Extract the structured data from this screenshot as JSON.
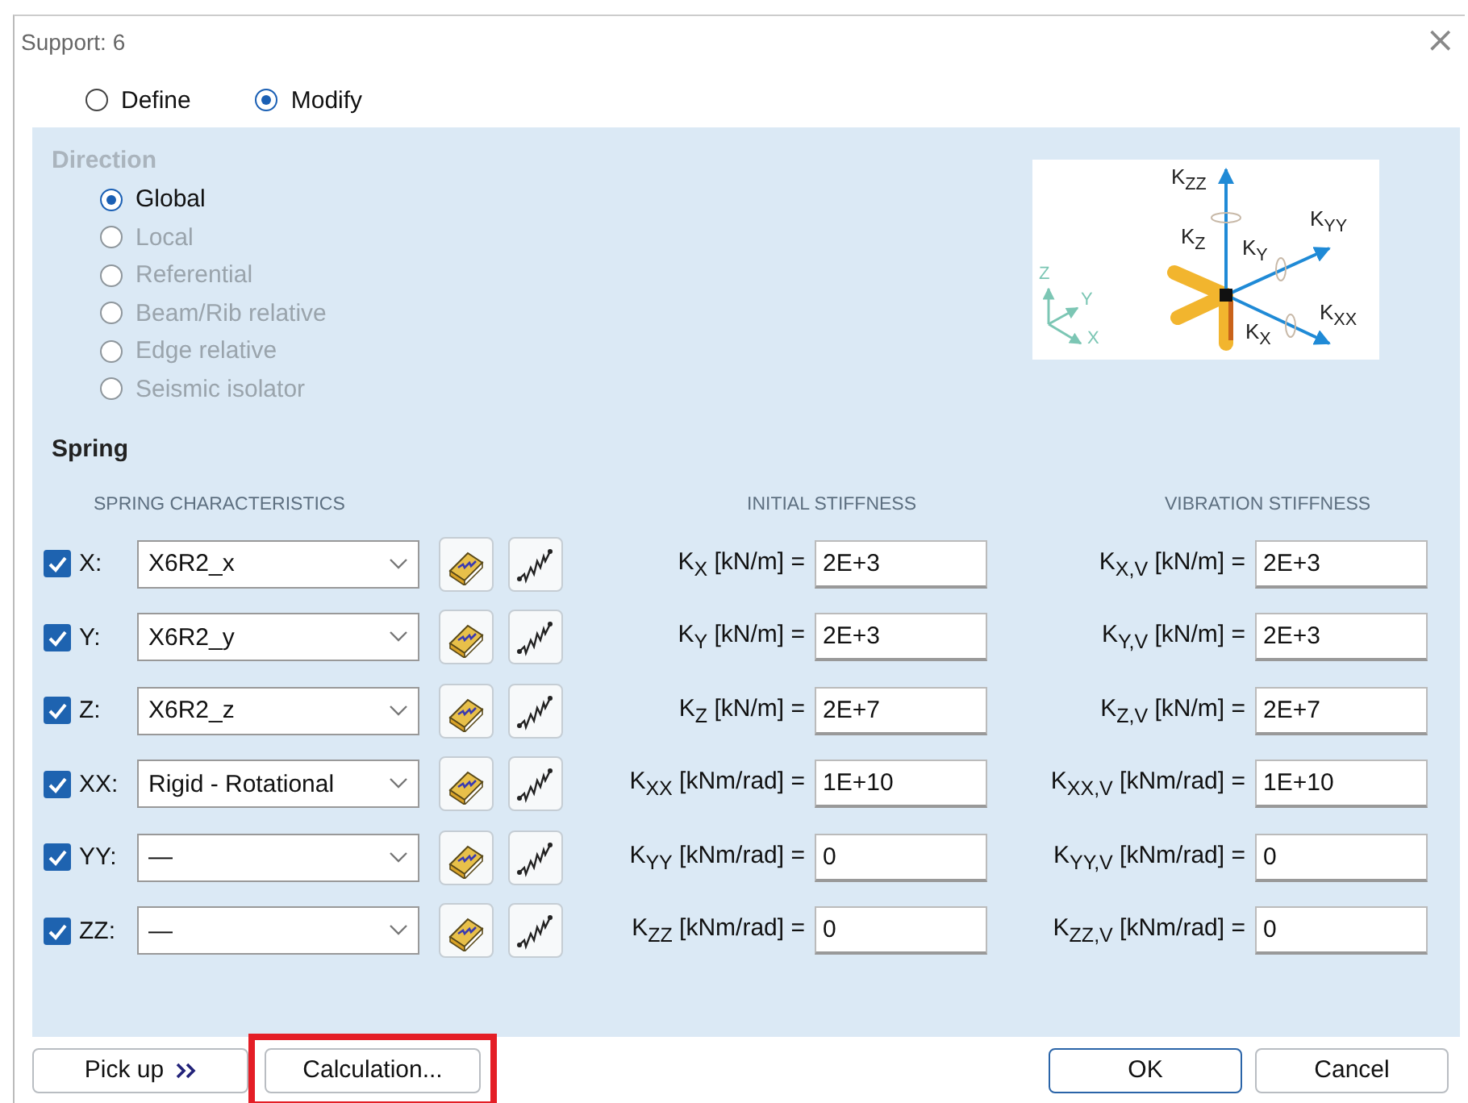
{
  "window": {
    "title": "Support: 6",
    "close": "×"
  },
  "mode": [
    {
      "label": "Define",
      "selected": false
    },
    {
      "label": "Modify",
      "selected": true
    }
  ],
  "direction": {
    "heading": "Direction",
    "disabled": true,
    "options": [
      {
        "label": "Global",
        "selected": true,
        "disabled": false
      },
      {
        "label": "Local",
        "selected": false,
        "disabled": true
      },
      {
        "label": "Referential",
        "selected": false,
        "disabled": true
      },
      {
        "label": "Beam/Rib relative",
        "selected": false,
        "disabled": true
      },
      {
        "label": "Edge relative",
        "selected": false,
        "disabled": true
      },
      {
        "label": "Seismic isolator",
        "selected": false,
        "disabled": true
      }
    ]
  },
  "diagram": {
    "stiffness_labels": [
      "K$_{ZZ}$",
      "K$_{Z}$",
      "K$_{Y}$",
      "K$_{YY}$",
      "K$_{XX}$",
      "K$_{X}$"
    ],
    "axis_labels": [
      "Z",
      "Y",
      "X"
    ]
  },
  "spring": {
    "heading": "Spring",
    "columns": [
      "SPRING CHARACTERISTICS",
      "INITIAL STIFFNESS",
      "VIBRATION STIFFNESS"
    ],
    "rows": [
      {
        "checked": true,
        "axis": "X:",
        "characteristic": "X6R2_x",
        "initial_label": "K$_{X}$ [kN/m] =",
        "initial": "2E+3",
        "vibration_label": "K$_{X,V}$ [kN/m] =",
        "vibration": "2E+3"
      },
      {
        "checked": true,
        "axis": "Y:",
        "characteristic": "X6R2_y",
        "initial_label": "K$_{Y}$ [kN/m] =",
        "initial": "2E+3",
        "vibration_label": "K$_{Y,V}$ [kN/m] =",
        "vibration": "2E+3"
      },
      {
        "checked": true,
        "axis": "Z:",
        "characteristic": "X6R2_z",
        "initial_label": "K$_{Z}$ [kN/m] =",
        "initial": "2E+7",
        "vibration_label": "K$_{Z,V}$ [kN/m] =",
        "vibration": "2E+7"
      },
      {
        "checked": true,
        "axis": "XX:",
        "characteristic": "Rigid - Rotational",
        "initial_label": "K$_{XX}$ [kNm/rad] =",
        "initial": "1E+10",
        "vibration_label": "K$_{XX,V}$ [kNm/rad] =",
        "vibration": "1E+10"
      },
      {
        "checked": true,
        "axis": "YY:",
        "characteristic": "—",
        "initial_label": "K$_{YY}$ [kNm/rad] =",
        "initial": "0",
        "vibration_label": "K$_{YY,V}$ [kNm/rad] =",
        "vibration": "0"
      },
      {
        "checked": true,
        "axis": "ZZ:",
        "characteristic": "—",
        "initial_label": "K$_{ZZ}$ [kNm/rad] =",
        "initial": "0",
        "vibration_label": "K$_{ZZ,V}$ [kNm/rad] =",
        "vibration": "0"
      }
    ]
  },
  "buttons": [
    {
      "label": "Pick up",
      "kind": "more",
      "highlighted": false,
      "default": false
    },
    {
      "label": "Calculation...",
      "kind": "plain",
      "highlighted": true,
      "default": false
    },
    {
      "label": "OK",
      "kind": "plain",
      "highlighted": false,
      "default": true
    },
    {
      "label": "Cancel",
      "kind": "plain",
      "highlighted": false,
      "default": false
    }
  ]
}
